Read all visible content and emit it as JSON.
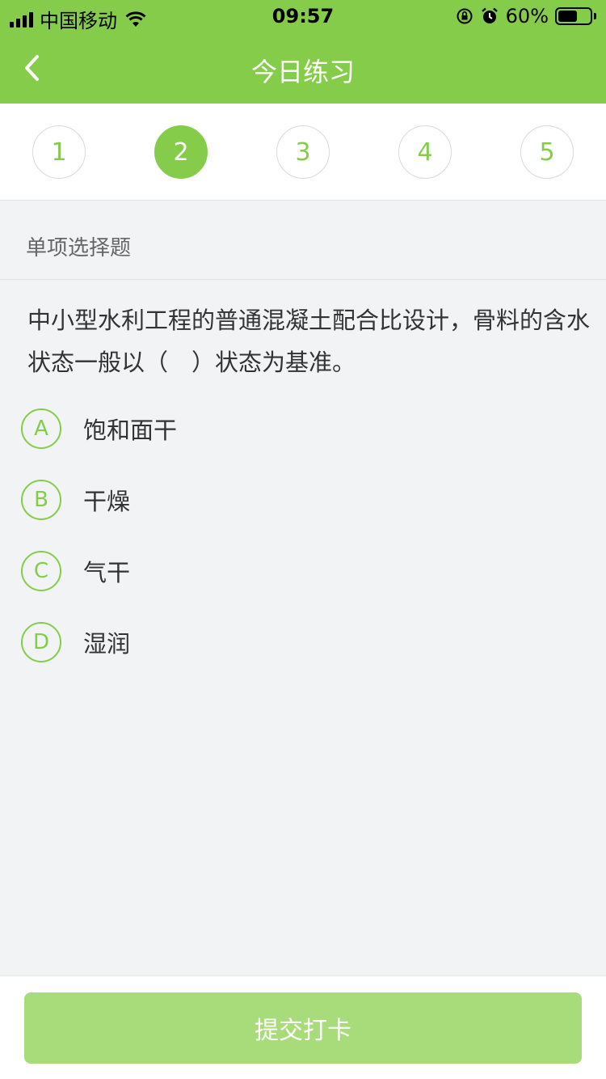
{
  "status_bar": {
    "carrier": "中国移动",
    "time": "09:57",
    "battery_text": "60%",
    "battery_level": 0.6
  },
  "nav": {
    "title": "今日练习",
    "back_icon": "chevron-left-icon"
  },
  "question_numbers": [
    "1",
    "2",
    "3",
    "4",
    "5"
  ],
  "active_question": 2,
  "question_type": "单项选择题",
  "question_text": "中小型水利工程的普通混凝土配合比设计，骨料的含水状态一般以（　）状态为基准。",
  "options": [
    {
      "letter": "A",
      "text": "饱和面干"
    },
    {
      "letter": "B",
      "text": "干燥"
    },
    {
      "letter": "C",
      "text": "气干"
    },
    {
      "letter": "D",
      "text": "湿润"
    }
  ],
  "submit_label": "提交打卡",
  "colors": {
    "accent": "#86cc4b",
    "submit_disabled": "#a8db79",
    "background": "#f2f3f5"
  }
}
